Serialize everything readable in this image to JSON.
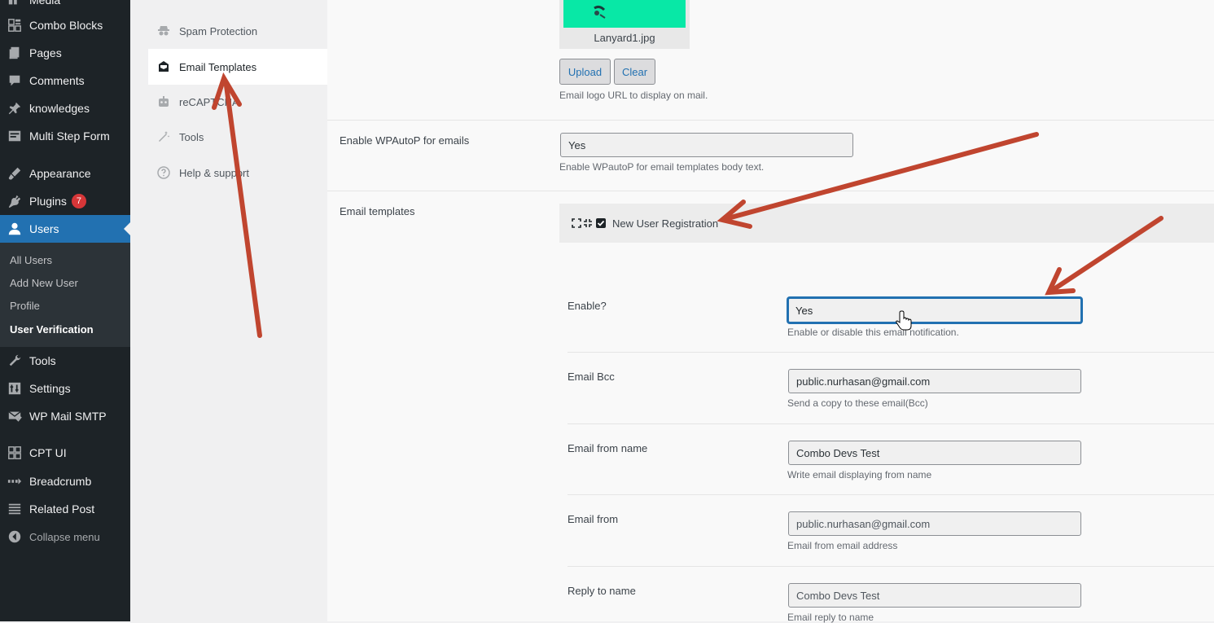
{
  "sidebar": {
    "items": [
      {
        "label": "Media",
        "icon": "media-icon"
      },
      {
        "label": "Combo Blocks",
        "icon": "blocks-icon"
      },
      {
        "label": "Pages",
        "icon": "pages-icon"
      },
      {
        "label": "Comments",
        "icon": "comments-icon"
      },
      {
        "label": "knowledges",
        "icon": "pin-icon"
      },
      {
        "label": "Multi Step Form",
        "icon": "form-icon"
      },
      {
        "label": "Appearance",
        "icon": "appearance-icon"
      },
      {
        "label": "Plugins",
        "icon": "plugins-icon",
        "badge": "7"
      },
      {
        "label": "Users",
        "icon": "users-icon"
      },
      {
        "label": "Tools",
        "icon": "tools-icon"
      },
      {
        "label": "Settings",
        "icon": "settings-icon"
      },
      {
        "label": "WP Mail SMTP",
        "icon": "mail-icon"
      },
      {
        "label": "CPT UI",
        "icon": "cpt-icon"
      },
      {
        "label": "Breadcrumb",
        "icon": "breadcrumb-icon"
      },
      {
        "label": "Related Post",
        "icon": "list-icon"
      },
      {
        "label": "Collapse menu",
        "icon": "collapse-icon"
      }
    ],
    "submenu": [
      "All Users",
      "Add New User",
      "Profile",
      "User Verification"
    ]
  },
  "settings_nav": {
    "items": [
      {
        "label": "Spam Protection",
        "icon": "spy-icon"
      },
      {
        "label": "Email Templates",
        "icon": "envelope-icon"
      },
      {
        "label": "reCAPTCHA",
        "icon": "robot-icon"
      },
      {
        "label": "Tools",
        "icon": "magic-wand-icon"
      },
      {
        "label": "Help & support",
        "icon": "question-icon"
      }
    ]
  },
  "main": {
    "logo": {
      "filename": "Lanyard1.jpg",
      "upload_label": "Upload",
      "clear_label": "Clear",
      "description": "Email logo URL to display on mail."
    },
    "wpautop": {
      "label": "Enable WPAutoP for emails",
      "value": "Yes",
      "description": "Enable WPautoP for email templates body text."
    },
    "email_templates": {
      "label": "Email templates",
      "accordion_title": "New User Registration",
      "accordion_checked": true,
      "fields": [
        {
          "label": "Enable?",
          "value": "Yes",
          "description": "Enable or disable this email notification."
        },
        {
          "label": "Email Bcc",
          "value": "public.nurhasan@gmail.com",
          "description": "Send a copy to these email(Bcc)"
        },
        {
          "label": "Email from name",
          "value": "Combo Devs Test",
          "description": "Write email displaying from name"
        },
        {
          "label": "Email from",
          "value": "public.nurhasan@gmail.com",
          "description": "Email from email address"
        },
        {
          "label": "Reply to name",
          "value": "Combo Devs Test",
          "description": "Email reply to name"
        }
      ]
    }
  },
  "colors": {
    "sidebar_bg": "#1d2327",
    "active_blue": "#2271b1",
    "badge_red": "#d63638",
    "annotation_arrow": "#c0452f",
    "thumbnail_green": "#08e8a6"
  }
}
